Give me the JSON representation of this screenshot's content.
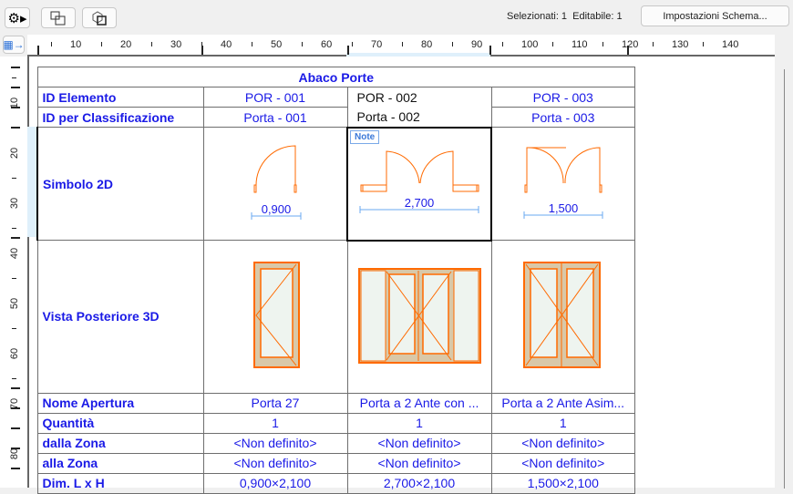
{
  "toolbar": {
    "status": "Selezionati: 1  Editabile: 1",
    "settings_label": "Impostazioni Schema..."
  },
  "ruler": {
    "h_labels": [
      "10",
      "20",
      "30",
      "40",
      "50",
      "60",
      "70",
      "80",
      "90",
      "100",
      "110",
      "120",
      "130",
      "140"
    ],
    "v_labels": [
      "10",
      "20",
      "30",
      "40",
      "50",
      "60",
      "70",
      "80"
    ]
  },
  "schedule": {
    "title": "Abaco Porte",
    "note_tag": "Note",
    "rows": [
      {
        "label": "ID Elemento",
        "values": [
          "POR - 001",
          "POR - 002",
          "POR - 003"
        ]
      },
      {
        "label": "ID per Classificazione",
        "values": [
          "Porta - 001",
          "Porta - 002",
          "Porta - 003"
        ]
      },
      {
        "label": "Simbolo 2D",
        "values": [
          "0,900",
          "2,700",
          "1,500"
        ]
      },
      {
        "label": "Vista Posteriore 3D",
        "values": []
      },
      {
        "label": "Nome Apertura",
        "values": [
          "Porta 27",
          "Porta a 2 Ante con ...",
          "Porta a 2 Ante Asim..."
        ]
      },
      {
        "label": "Quantità",
        "values": [
          "1",
          "1",
          "1"
        ]
      },
      {
        "label": "dalla Zona",
        "values": [
          "<Non definito>",
          "<Non definito>",
          "<Non definito>"
        ]
      },
      {
        "label": "alla Zona",
        "values": [
          "<Non definito>",
          "<Non definito>",
          "<Non definito>"
        ]
      },
      {
        "label": "Dim. L x H",
        "values": [
          "0,900×2,100",
          "2,700×2,100",
          "1,500×2,100"
        ]
      }
    ]
  },
  "colors": {
    "accent": "#1a1ae6",
    "door": "#ff6a00",
    "frame": "#d9c8a8",
    "selection": "#dff0fb"
  }
}
